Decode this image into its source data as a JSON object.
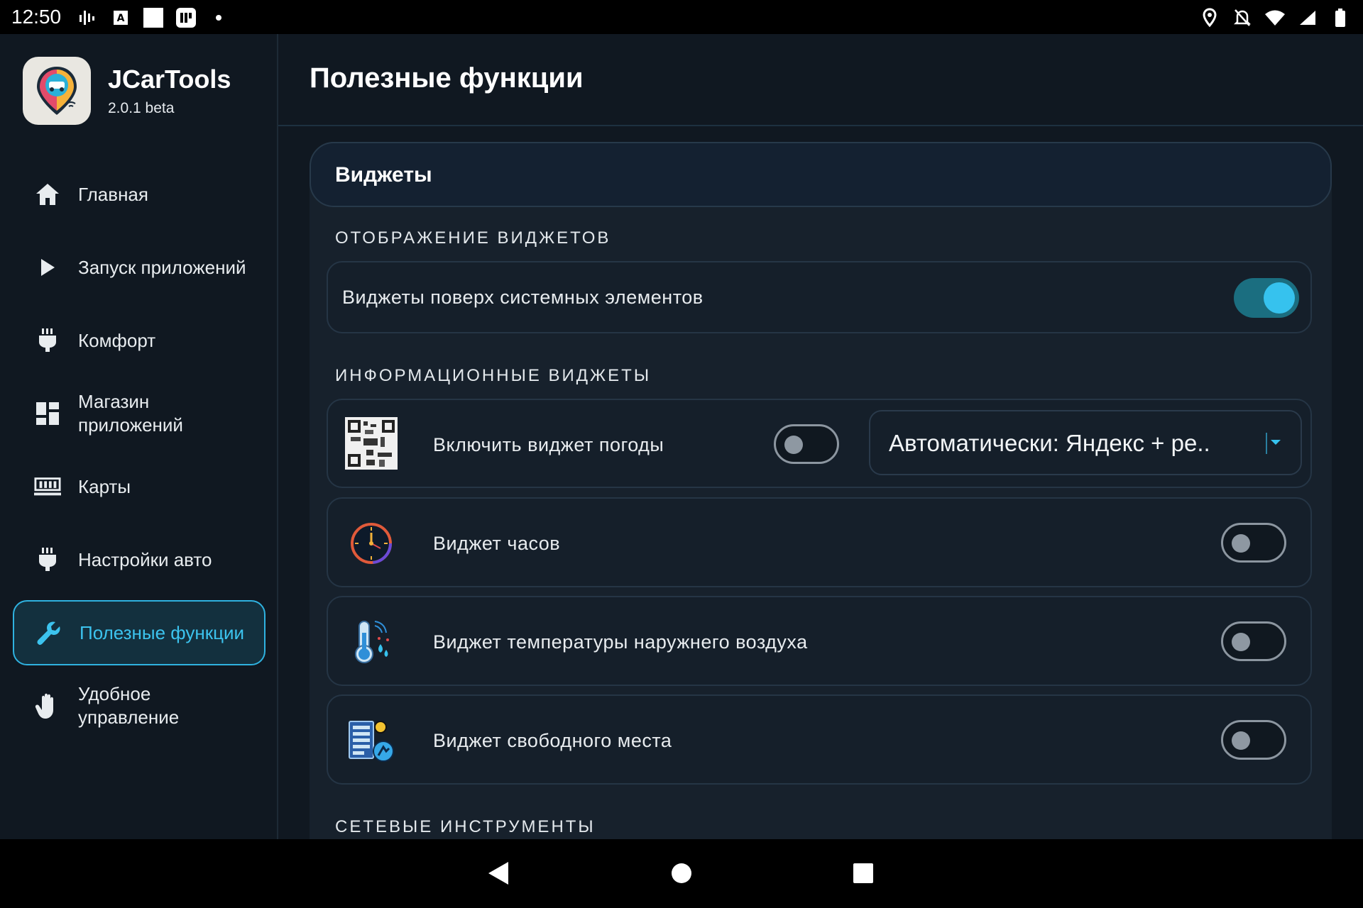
{
  "status_bar": {
    "time": "12:50",
    "left_icons": [
      "signal-bars-icon",
      "font-a-icon",
      "white-square-icon",
      "app-notification-icon",
      "dot-icon"
    ],
    "right_icons": [
      "location-icon",
      "notifications-off-icon",
      "wifi-icon",
      "cell-signal-icon",
      "battery-icon"
    ]
  },
  "app": {
    "name": "JCarTools",
    "version": "2.0.1 beta"
  },
  "sidebar": {
    "items": [
      {
        "label": "Главная",
        "icon": "home-icon",
        "active": false
      },
      {
        "label": "Запуск приложений",
        "icon": "play-icon",
        "active": false
      },
      {
        "label": "Комфорт",
        "icon": "plug-icon",
        "active": false
      },
      {
        "label": "Магазин приложений",
        "icon": "dashboard-icon",
        "active": false
      },
      {
        "label": "Карты",
        "icon": "map-icon",
        "active": false
      },
      {
        "label": "Настройки авто",
        "icon": "plug-icon",
        "active": false
      },
      {
        "label": "Полезные функции",
        "icon": "wrench-icon",
        "active": true
      },
      {
        "label": "Удобное управление",
        "icon": "hand-icon",
        "active": false
      }
    ],
    "active_color": "#3cc3ee"
  },
  "main": {
    "page_title": "Полезные функции",
    "panel_title": "Виджеты",
    "sections": {
      "display": "ОТОБРАЖЕНИЕ ВИДЖЕТОВ",
      "info": "ИНФОРМАЦИОННЫЕ ВИДЖЕТЫ",
      "network": "СЕТЕВЫЕ ИНСТРУМЕНТЫ"
    },
    "overlay_toggle": {
      "label": "Виджеты поверх системных элементов",
      "on": true
    },
    "weather": {
      "label": "Включить виджет погоды",
      "on": false,
      "icon": "qr-code-icon",
      "dropdown_value": "Автоматически: Яндекс + ре.."
    },
    "clock": {
      "label": "Виджет часов",
      "on": false,
      "icon": "clock-icon"
    },
    "temperature": {
      "label": "Виджет температуры наружнего воздуха",
      "on": false,
      "icon": "thermometer-icon"
    },
    "storage": {
      "label": "Виджет свободного места",
      "on": false,
      "icon": "storage-icon"
    }
  },
  "nav_bar": {
    "buttons": [
      "back-icon",
      "home-circle-icon",
      "recents-icon"
    ]
  }
}
